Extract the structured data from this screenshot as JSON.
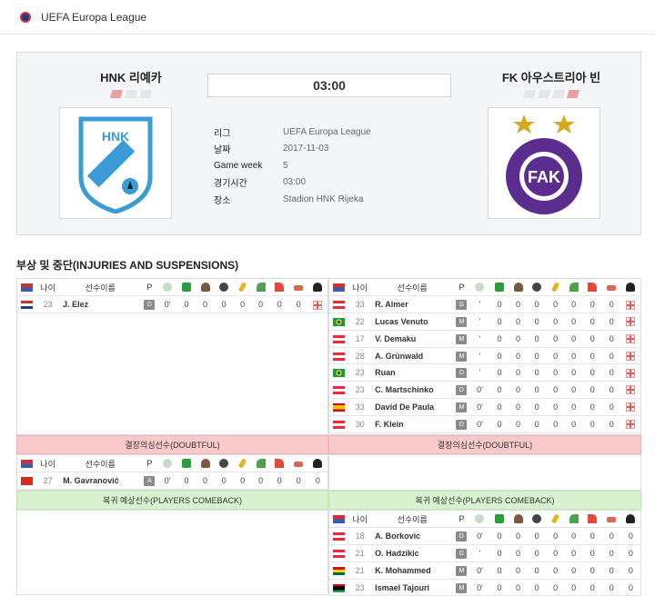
{
  "header": {
    "title": "UEFA Europa League"
  },
  "match": {
    "home": {
      "name": "HNK 리예카",
      "form": [
        "L",
        "D",
        "D"
      ]
    },
    "away": {
      "name": "FK 아우스트리아 빈",
      "form": [
        "D",
        "D",
        "D",
        "L"
      ]
    },
    "score": "03:00",
    "info": [
      {
        "k": "리그",
        "v": "UEFA Europa League"
      },
      {
        "k": "날짜",
        "v": "2017-11-03"
      },
      {
        "k": "Game week",
        "v": "5"
      },
      {
        "k": "경기시간",
        "v": "03:00"
      },
      {
        "k": "장소",
        "v": "Stadion HNK Rijeka"
      }
    ]
  },
  "section_title": "부상 및 중단(INJURIES AND SUSPENSIONS)",
  "columns": {
    "age": "나이",
    "name": "선수이름",
    "pos": "P"
  },
  "injured_home": [
    {
      "flag": "HR",
      "age": "23",
      "name": "J. Elez",
      "pos": "D",
      "min": "0'",
      "stats": [
        "0",
        "0",
        "0",
        "0",
        "0",
        "0",
        "0",
        "0"
      ]
    }
  ],
  "injured_away": [
    {
      "flag": "AT",
      "age": "33",
      "name": "R. Almer",
      "pos": "G",
      "min": "'",
      "stats": [
        "0",
        "0",
        "0",
        "0",
        "0",
        "0",
        "0",
        "0"
      ]
    },
    {
      "flag": "BR",
      "age": "22",
      "name": "Lucas Venuto",
      "pos": "M",
      "min": "'",
      "stats": [
        "0",
        "0",
        "0",
        "0",
        "0",
        "0",
        "0",
        "0"
      ]
    },
    {
      "flag": "AT",
      "age": "17",
      "name": "V. Demaku",
      "pos": "M",
      "min": "'",
      "stats": [
        "0",
        "0",
        "0",
        "0",
        "0",
        "0",
        "0",
        "0"
      ]
    },
    {
      "flag": "AT",
      "age": "28",
      "name": "A. Grünwald",
      "pos": "M",
      "min": "'",
      "stats": [
        "0",
        "0",
        "0",
        "0",
        "0",
        "0",
        "0",
        "0"
      ]
    },
    {
      "flag": "BR",
      "age": "23",
      "name": "Ruan",
      "pos": "D",
      "min": "'",
      "stats": [
        "0",
        "0",
        "0",
        "0",
        "0",
        "0",
        "0",
        "0"
      ]
    },
    {
      "flag": "AT",
      "age": "23",
      "name": "C. Martschinko",
      "pos": "D",
      "min": "0'",
      "stats": [
        "0",
        "0",
        "0",
        "0",
        "0",
        "0",
        "0",
        "0"
      ]
    },
    {
      "flag": "ES",
      "age": "33",
      "name": "David De Paula",
      "pos": "M",
      "min": "0'",
      "stats": [
        "0",
        "0",
        "0",
        "0",
        "0",
        "0",
        "0",
        "0"
      ]
    },
    {
      "flag": "AT",
      "age": "30",
      "name": "F. Klein",
      "pos": "D",
      "min": "0'",
      "stats": [
        "0",
        "0",
        "0",
        "0",
        "0",
        "0",
        "0",
        "0"
      ]
    }
  ],
  "doubtful_label": "결장의심선수(DOUBTFUL)",
  "doubtful_home": [
    {
      "flag": "CH",
      "age": "27",
      "name": "M. Gavranović",
      "pos": "A",
      "min": "0'",
      "stats": [
        "0",
        "0",
        "0",
        "0",
        "0",
        "0",
        "0",
        "0"
      ]
    }
  ],
  "comeback_label": "복귀 예상선수(PLAYERS COMEBACK)",
  "comeback_away": [
    {
      "flag": "AT",
      "age": "18",
      "name": "A. Borkovic",
      "pos": "D",
      "min": "0'",
      "stats": [
        "0",
        "0",
        "0",
        "0",
        "0",
        "0",
        "0",
        "0"
      ]
    },
    {
      "flag": "AT",
      "age": "21",
      "name": "O. Hadzikic",
      "pos": "G",
      "min": "'",
      "stats": [
        "0",
        "0",
        "0",
        "0",
        "0",
        "0",
        "0",
        "0"
      ]
    },
    {
      "flag": "GH",
      "age": "21",
      "name": "K. Mohammed",
      "pos": "M",
      "min": "0'",
      "stats": [
        "0",
        "0",
        "0",
        "0",
        "0",
        "0",
        "0",
        "0"
      ]
    },
    {
      "flag": "LY",
      "age": "23",
      "name": "Ismael Tajouri",
      "pos": "M",
      "min": "0'",
      "stats": [
        "0",
        "0",
        "0",
        "0",
        "0",
        "0",
        "0",
        "0"
      ]
    }
  ],
  "stat_icons": [
    "timer-icon",
    "green-shirt-icon",
    "player-icon",
    "ball-icon",
    "yellow-card-icon",
    "assist-icon",
    "red-arrow-icon",
    "sub-icon",
    "referee-icon"
  ],
  "colors": {
    "header_red": "#f9c9c9",
    "header_green": "#d8f2cf",
    "loss": "#e9a0a0"
  }
}
